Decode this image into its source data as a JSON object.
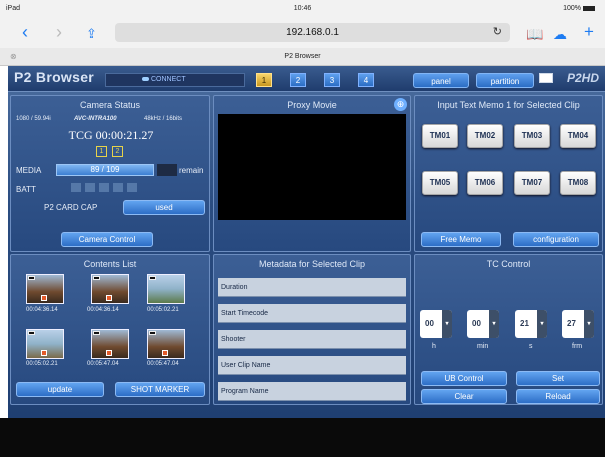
{
  "status_bar": {
    "left": "iPad",
    "time": "10:46",
    "battery": "100%"
  },
  "safari": {
    "back_icon": "chevron-left-icon",
    "forward_icon": "chevron-right-icon",
    "share_icon": "share-icon",
    "url": "192.168.0.1",
    "reload_icon": "reload-icon",
    "bookmarks_icon": "book-icon",
    "cloud_icon": "cloud-icon",
    "add_icon": "plus-icon"
  },
  "tab": {
    "title": "P2 Browser"
  },
  "app": {
    "brand": "P2 Browser",
    "connect_label": "CONNECT",
    "slots": [
      "1",
      "2",
      "3",
      "4"
    ],
    "active_slot": "1",
    "panel_label": "panel",
    "partition_label": "partition",
    "logo": "P2HD"
  },
  "camera_status": {
    "title": "Camera Status",
    "format": "1080 / 59.94i",
    "codec": "AVC-INTRA100",
    "audio": "48kHz / 16bits",
    "tcg": "TCG 00:00:21.27",
    "cards": [
      "1",
      "2"
    ],
    "media_label": "MEDIA",
    "media_value": "89 / 109",
    "media_remain": "remain",
    "batt_label": "BATT",
    "cap_label": "P2 CARD CAP",
    "cap_value": "used",
    "camera_control": "Camera Control"
  },
  "proxy": {
    "title": "Proxy Movie",
    "zoom_icon": "zoom-icon"
  },
  "memo": {
    "title": "Input Text Memo 1 for Selected Clip",
    "buttons": [
      "TM01",
      "TM02",
      "TM03",
      "TM04",
      "TM05",
      "TM06",
      "TM07",
      "TM08"
    ],
    "free_memo": "Free Memo",
    "configuration": "configuration"
  },
  "contents": {
    "title": "Contents List",
    "thumbs": [
      {
        "index": "01",
        "time": "00:04:36.14"
      },
      {
        "index": "02",
        "time": "00:04:36.14"
      },
      {
        "index": "03",
        "time": "00:05:02.21"
      },
      {
        "index": "04",
        "time": "00:05:02.21"
      },
      {
        "index": "05",
        "time": "00:05:47.04"
      },
      {
        "index": "06",
        "time": "00:05:47.04"
      }
    ],
    "update": "update",
    "shot_marker": "SHOT MARKER"
  },
  "metadata": {
    "title": "Metadata for Selected Clip",
    "rows": [
      "Duration",
      "Start Timecode",
      "Shooter",
      "User Clip Name",
      "Program Name"
    ]
  },
  "tc": {
    "title": "TC Control",
    "values": [
      "00",
      "00",
      "21",
      "27"
    ],
    "units": [
      "h",
      "min",
      "s",
      "frm"
    ],
    "ub_control": "UB Control",
    "set": "Set",
    "clear": "Clear",
    "reload": "Reload"
  }
}
